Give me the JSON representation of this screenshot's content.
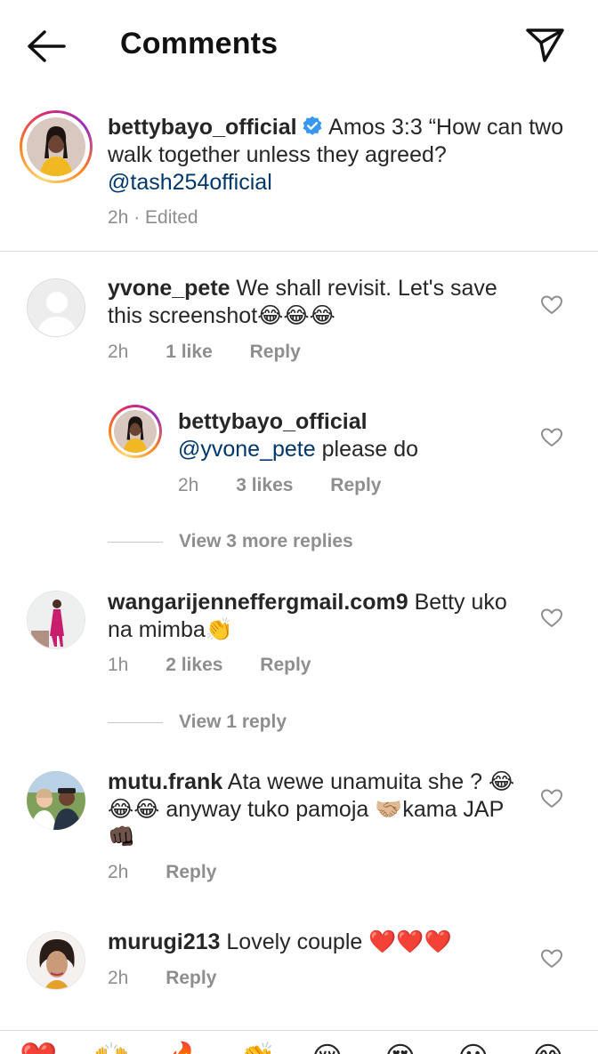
{
  "header": {
    "title": "Comments"
  },
  "caption": {
    "username": "bettybayo_official",
    "text": "Amos 3:3 “How can two walk together unless they  agreed?",
    "mention": "@tash254official",
    "meta": "2h · Edited"
  },
  "comments": [
    {
      "username": "yvone_pete",
      "text": "We shall revisit. Let's save this screenshot😂😂😂",
      "time": "2h",
      "likes": "1 like",
      "reply_label": "Reply"
    },
    {
      "username": "bettybayo_official",
      "mention": "@yvone_pete",
      "text": "please do",
      "time": "2h",
      "likes": "3 likes",
      "reply_label": "Reply"
    },
    {
      "username": "wangarijenneffergmail.com9",
      "text": "Betty uko na mimba👏",
      "time": "1h",
      "likes": "2 likes",
      "reply_label": "Reply"
    },
    {
      "username": "mutu.frank",
      "text": "Ata wewe unamuita she ? 😂😂😂 anyway tuko pamoja 🤝🏼kama JAP👊🏿",
      "time": "2h",
      "reply_label": "Reply"
    },
    {
      "username": "murugi213",
      "text": "Lovely couple ❤️❤️❤️",
      "time": "2h",
      "reply_label": "Reply"
    }
  ],
  "view_replies": [
    "View 3 more replies",
    "View 1 reply"
  ],
  "emoji_bar": [
    "❤️",
    "🙌",
    "🔥",
    "👏",
    "😢",
    "😍",
    "😮",
    "😂"
  ],
  "colors": {
    "mention": "#00376b",
    "verified": "#3897f0",
    "heart": "#ed4956",
    "meta": "#8e8e8e"
  }
}
